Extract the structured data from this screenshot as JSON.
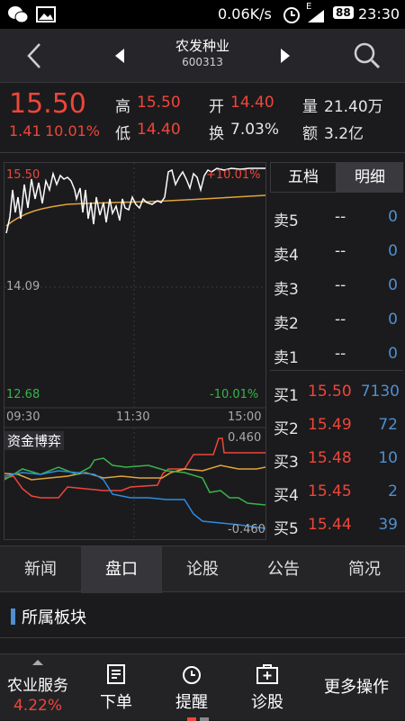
{
  "status_bar": {
    "net_speed": "0.06K/s",
    "battery": "88",
    "time": "23:30",
    "signal": "E"
  },
  "nav": {
    "stock_name": "农发种业",
    "stock_code": "600313"
  },
  "quote": {
    "price": "15.50",
    "change": "1.41",
    "change_pct": "10.01%",
    "high_label": "高",
    "high": "15.50",
    "low_label": "低",
    "low": "14.40",
    "open_label": "开",
    "open": "14.40",
    "turnover_label": "换",
    "turnover": "7.03%",
    "volume_label": "量",
    "volume": "21.40万",
    "amount_label": "额",
    "amount": "3.2亿"
  },
  "chart": {
    "y_high": "15.50",
    "y_mid": "14.09",
    "y_low": "12.68",
    "pct_high": "+10.01%",
    "pct_low": "-10.01%",
    "times": [
      "09:30",
      "11:30",
      "15:00"
    ],
    "fund_title": "资金博弈",
    "fund_high": "0.460",
    "fund_low": "-0.460"
  },
  "chart_data": {
    "type": "line",
    "x": [
      "09:30",
      "11:30",
      "15:00"
    ],
    "ylim": [
      12.68,
      15.5
    ],
    "series": []
  },
  "book": {
    "tab_five": "五档",
    "tab_detail": "明细",
    "asks": [
      {
        "label": "卖5",
        "price": "--",
        "vol": "0"
      },
      {
        "label": "卖4",
        "price": "--",
        "vol": "0"
      },
      {
        "label": "卖3",
        "price": "--",
        "vol": "0"
      },
      {
        "label": "卖2",
        "price": "--",
        "vol": "0"
      },
      {
        "label": "卖1",
        "price": "--",
        "vol": "0"
      }
    ],
    "bids": [
      {
        "label": "买1",
        "price": "15.50",
        "vol": "7130"
      },
      {
        "label": "买2",
        "price": "15.49",
        "vol": "72"
      },
      {
        "label": "买3",
        "price": "15.48",
        "vol": "10"
      },
      {
        "label": "买4",
        "price": "15.45",
        "vol": "2"
      },
      {
        "label": "买5",
        "price": "15.44",
        "vol": "39"
      }
    ]
  },
  "tabs": [
    "新闻",
    "盘口",
    "论股",
    "公告",
    "简况"
  ],
  "sector": {
    "title": "所属板块"
  },
  "bottom": {
    "sector_name": "农业服务",
    "sector_pct": "4.22%",
    "order": "下单",
    "alert": "提醒",
    "diagnose": "诊股",
    "more": "更多操作"
  },
  "colors": {
    "up": "#f0453a",
    "down": "#38b44a",
    "neutral_num": "#4f8fd0",
    "price_line": "#ffffff",
    "avg_line": "#e2a33a"
  }
}
